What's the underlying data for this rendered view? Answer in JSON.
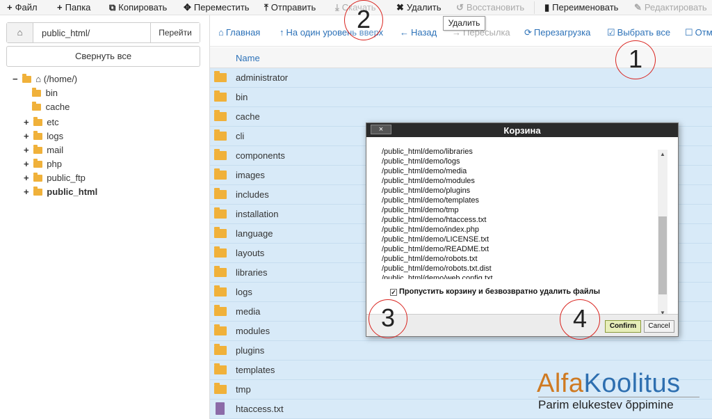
{
  "toolbar": {
    "file": "Файл",
    "folder": "Папка",
    "copy": "Копировать",
    "move": "Переместить",
    "upload": "Отправить",
    "download": "Скачать",
    "delete": "Удалить",
    "restore": "Восстановить",
    "rename": "Переименовать",
    "edit": "Редактировать"
  },
  "tooltip": "Удалить",
  "sidebar": {
    "path_value": "public_html/",
    "go_label": "Перейти",
    "collapse_label": "Свернуть все",
    "tree": {
      "root": "(/home/)",
      "items": [
        "bin",
        "cache",
        "etc",
        "logs",
        "mail",
        "php",
        "public_ftp",
        "public_html"
      ]
    }
  },
  "navbar": {
    "home": "Главная",
    "up_level": "На один уровень вверх",
    "back": "Назад",
    "forward": "Пересылка",
    "reload": "Перезагрузка",
    "select_all": "Выбрать все",
    "unselect": "Отм"
  },
  "columns": {
    "name": "Name"
  },
  "files": [
    {
      "name": "administrator",
      "type": "folder"
    },
    {
      "name": "bin",
      "type": "folder"
    },
    {
      "name": "cache",
      "type": "folder"
    },
    {
      "name": "cli",
      "type": "folder"
    },
    {
      "name": "components",
      "type": "folder"
    },
    {
      "name": "images",
      "type": "folder"
    },
    {
      "name": "includes",
      "type": "folder"
    },
    {
      "name": "installation",
      "type": "folder"
    },
    {
      "name": "language",
      "type": "folder"
    },
    {
      "name": "layouts",
      "type": "folder"
    },
    {
      "name": "libraries",
      "type": "folder"
    },
    {
      "name": "logs",
      "type": "folder"
    },
    {
      "name": "media",
      "type": "folder"
    },
    {
      "name": "modules",
      "type": "folder"
    },
    {
      "name": "plugins",
      "type": "folder"
    },
    {
      "name": "templates",
      "type": "folder"
    },
    {
      "name": "tmp",
      "type": "folder"
    },
    {
      "name": "htaccess.txt",
      "type": "file"
    }
  ],
  "modal": {
    "title": "Корзина",
    "close": "×",
    "list": [
      "/public_html/demo/libraries",
      "/public_html/demo/logs",
      "/public_html/demo/media",
      "/public_html/demo/modules",
      "/public_html/demo/plugins",
      "/public_html/demo/templates",
      "/public_html/demo/tmp",
      "/public_html/demo/htaccess.txt",
      "/public_html/demo/index.php",
      "/public_html/demo/LICENSE.txt",
      "/public_html/demo/README.txt",
      "/public_html/demo/robots.txt",
      "/public_html/demo/robots.txt.dist",
      "/public_html/demo/web.config.txt"
    ],
    "skip_trash_label": "Пропустить корзину и безвозвратно удалить файлы",
    "skip_trash_checked": true,
    "confirm": "Confirm",
    "cancel": "Cancel"
  },
  "annotations": [
    "1",
    "2",
    "3",
    "4"
  ],
  "watermark": {
    "brand_a": "Alfa",
    "brand_b": "Koolitus",
    "tagline": "Parim elukestev õppimine"
  },
  "colors": {
    "accent_blue": "#2d72b8",
    "selected_row": "#d8eaf8",
    "folder": "#f0b13a",
    "annotation_red": "#d9241f"
  }
}
